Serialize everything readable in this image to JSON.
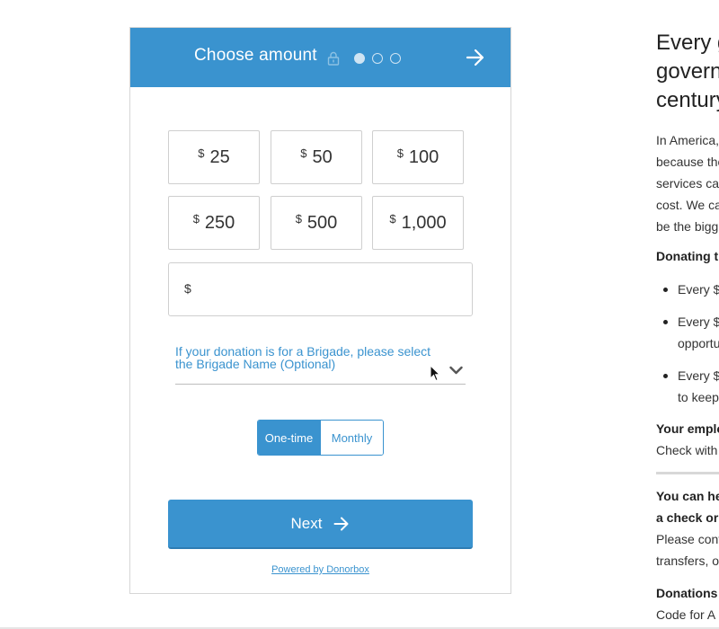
{
  "widget": {
    "header": {
      "title": "Choose amount",
      "icons": [
        "lock-icon",
        "arrow-right-icon"
      ],
      "steps_total": 3,
      "current_step": 1
    },
    "amounts": [
      {
        "currency": "$",
        "value": "25"
      },
      {
        "currency": "$",
        "value": "50"
      },
      {
        "currency": "$",
        "value": "100"
      },
      {
        "currency": "$",
        "value": "250"
      },
      {
        "currency": "$",
        "value": "500"
      },
      {
        "currency": "$",
        "value": "1,000"
      }
    ],
    "custom_amount": {
      "currency": "$",
      "value": ""
    },
    "brigade": {
      "line1": "If your donation is for a Brigade, please select",
      "line2": "the Brigade Name (Optional)",
      "icon": "chevron-down-icon"
    },
    "frequency": {
      "options": [
        "One-time",
        "Monthly"
      ],
      "selected": "One-time"
    },
    "next_button": {
      "label": "Next",
      "icon": "arrow-right-icon"
    },
    "powered_by": "Powered by Donorbox",
    "colors": {
      "accent": "#3a93cf",
      "border": "#cfcfcf"
    }
  },
  "article": {
    "heading_lines": [
      "Every g",
      "governm",
      "century"
    ],
    "para_lines": [
      "In America,",
      "because the",
      "services ca",
      "cost. We ca",
      "be the bigg"
    ],
    "donating_title": "Donating t",
    "bullets": [
      {
        "line1": "Every $"
      },
      {
        "line1": "Every $",
        "line2": "opportu"
      },
      {
        "line1": "Every $",
        "line2": "to keep"
      }
    ],
    "employer_title": "Your emplo",
    "employer_text": "Check with",
    "help_title_1": "You can he",
    "help_title_2": "a check or",
    "help_text_1": "Please cont",
    "help_text_2": "transfers, o",
    "donations_title": "Donations",
    "donations_text": "Code for A"
  }
}
